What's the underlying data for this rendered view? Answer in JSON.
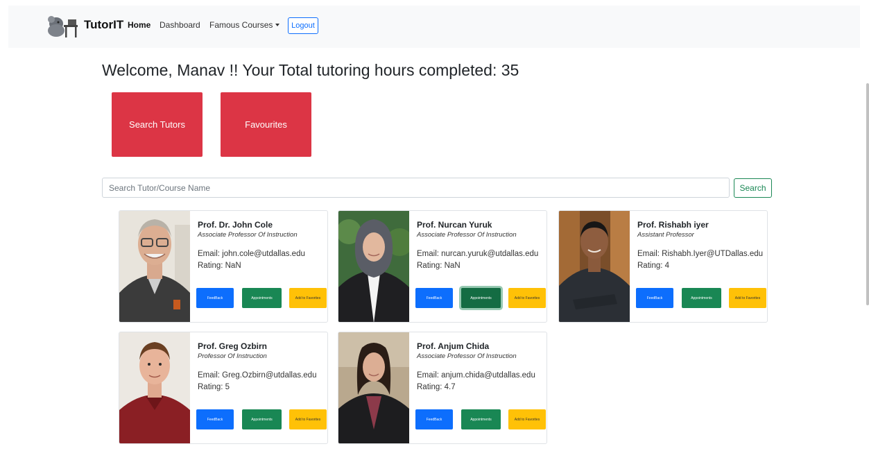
{
  "navbar": {
    "brand": "TutorIT",
    "links": [
      "Home",
      "Dashboard",
      "Famous Courses"
    ],
    "logout_label": "Logout"
  },
  "welcome": "Welcome, Manav !! Your Total tutoring hours completed: 35",
  "actions": {
    "search_tutors": "Search Tutors",
    "favourites": "Favourites"
  },
  "search": {
    "placeholder": "Search Tutor/Course Name",
    "value": "",
    "button": "Search"
  },
  "buttons": {
    "feedback": "FeedBack",
    "appointments": "Appointments",
    "favorite": "Add to Favorites"
  },
  "tutors": [
    {
      "name": "Prof. Dr. John Cole",
      "title": "Associate Professor Of Instruction",
      "email": "Email: john.cole@utdallas.edu",
      "rating": "Rating: NaN"
    },
    {
      "name": "Prof. Nurcan Yuruk",
      "title": "Associate Professor Of Instruction",
      "email": "Email: nurcan.yuruk@utdallas.edu",
      "rating": "Rating: NaN"
    },
    {
      "name": "Prof. Rishabh iyer",
      "title": "Assistant Professor",
      "email": "Email: Rishabh.Iyer@UTDallas.edu",
      "rating": "Rating: 4"
    },
    {
      "name": "Prof. Greg Ozbirn",
      "title": "Professor Of Instruction",
      "email": "Email: Greg.Ozbirn@utdallas.edu",
      "rating": "Rating: 5"
    },
    {
      "name": "Prof. Anjum Chida",
      "title": "Associate Professor Of Instruction",
      "email": "Email: anjum.chida@utdallas.edu",
      "rating": "Rating: 4.7"
    }
  ],
  "colors": {
    "primary": "#0d6efd",
    "success": "#198754",
    "warning": "#ffc107",
    "danger": "#dc3545"
  }
}
